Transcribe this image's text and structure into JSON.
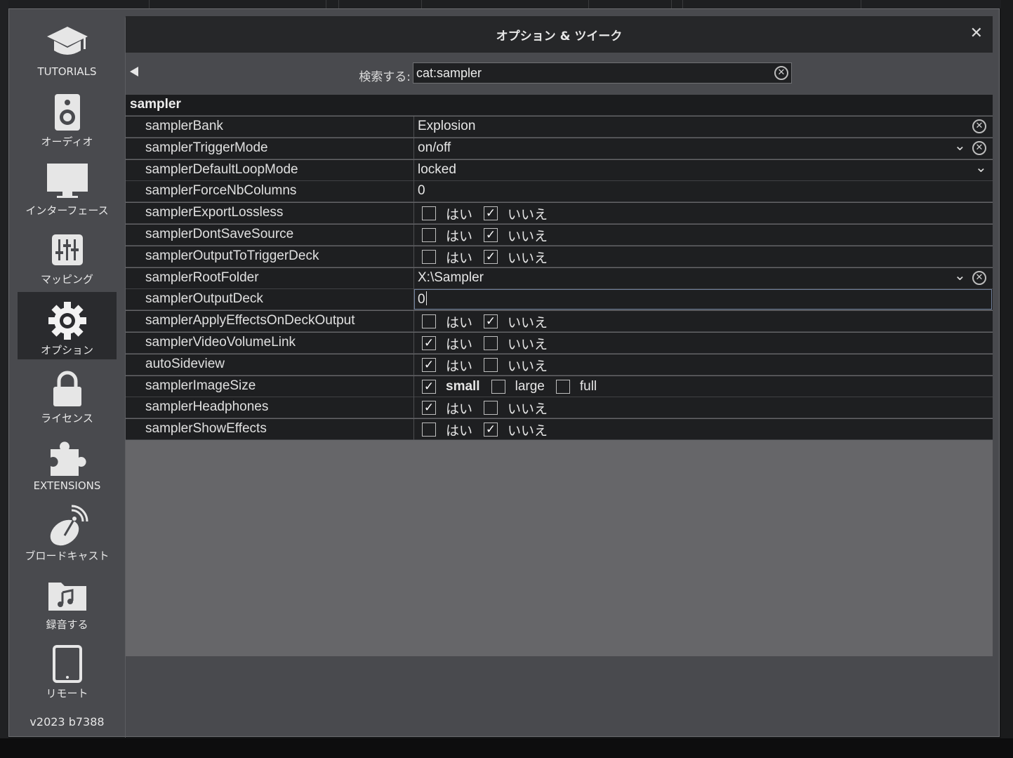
{
  "dialog": {
    "title": "オプション & ツイーク",
    "close_glyph": "✕"
  },
  "sidebar": {
    "items": [
      {
        "label": "TUTORIALS",
        "icon": "graduation-cap-icon"
      },
      {
        "label": "オーディオ",
        "icon": "speaker-icon"
      },
      {
        "label": "インターフェース",
        "icon": "monitor-icon"
      },
      {
        "label": "マッピング",
        "icon": "mixer-sliders-icon"
      },
      {
        "label": "オプション",
        "icon": "gear-icon",
        "active": true
      },
      {
        "label": "ライセンス",
        "icon": "lock-icon"
      },
      {
        "label": "EXTENSIONS",
        "icon": "puzzle-icon"
      },
      {
        "label": "ブロードキャスト",
        "icon": "satellite-dish-icon"
      },
      {
        "label": "録音する",
        "icon": "music-folder-icon"
      },
      {
        "label": "リモート",
        "icon": "tablet-icon"
      }
    ],
    "version": "v2023 b7388"
  },
  "search": {
    "label": "検索する:",
    "value": "cat:sampler"
  },
  "table": {
    "category": "sampler",
    "yes": "はい",
    "no": "いいえ",
    "rows": [
      {
        "key": "samplerBank",
        "type": "text",
        "value": "Explosion",
        "clear": true
      },
      {
        "key": "samplerTriggerMode",
        "type": "dropdown",
        "value": "on/off",
        "clear": true
      },
      {
        "key": "samplerDefaultLoopMode",
        "type": "dropdown",
        "value": "locked"
      },
      {
        "key": "samplerForceNbColumns",
        "type": "text",
        "value": "0"
      },
      {
        "key": "samplerExportLossless",
        "type": "bool",
        "value": false
      },
      {
        "key": "samplerDontSaveSource",
        "type": "bool",
        "value": false
      },
      {
        "key": "samplerOutputToTriggerDeck",
        "type": "bool",
        "value": false
      },
      {
        "key": "samplerRootFolder",
        "type": "dropdown",
        "value": "X:\\Sampler",
        "clear": true
      },
      {
        "key": "samplerOutputDeck",
        "type": "edit",
        "value": "0"
      },
      {
        "key": "samplerApplyEffectsOnDeckOutput",
        "type": "bool",
        "value": false
      },
      {
        "key": "samplerVideoVolumeLink",
        "type": "bool",
        "value": true
      },
      {
        "key": "autoSideview",
        "type": "bool",
        "value": true
      },
      {
        "key": "samplerImageSize",
        "type": "choice",
        "options": [
          "small",
          "large",
          "full"
        ],
        "selected": "small"
      },
      {
        "key": "samplerHeadphones",
        "type": "bool",
        "value": true
      },
      {
        "key": "samplerShowEffects",
        "type": "bool",
        "value": false
      }
    ]
  }
}
